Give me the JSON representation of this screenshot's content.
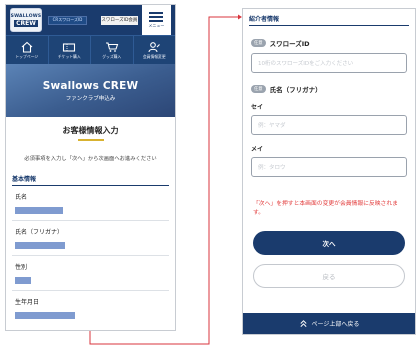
{
  "left": {
    "logo": {
      "line1": "SWALLOWS",
      "line2": "CREW"
    },
    "crew_id_badge": "CRスワローズID",
    "header_button": "スワローズID会員",
    "menu_label": "メニュー",
    "nav": [
      {
        "icon": "home-icon",
        "label": "トップページ"
      },
      {
        "icon": "ticket-icon",
        "label": "チケット購入"
      },
      {
        "icon": "cart-icon",
        "label": "グッズ購入"
      },
      {
        "icon": "user-edit-icon",
        "label": "会員情報変更"
      }
    ],
    "hero": {
      "title": "Swallows CREW",
      "subtitle": "ファンクラブ申込み"
    },
    "form_title": "お客様情報入力",
    "notice": "必須事項を入力し「次へ」から次画面へお進みください",
    "section": "基本情報",
    "fields": [
      {
        "label": "氏名"
      },
      {
        "label": "氏名（フリガナ）"
      },
      {
        "label": "性別"
      },
      {
        "label": "生年月日"
      }
    ]
  },
  "right": {
    "section": "紹介者情報",
    "badge": "任意",
    "id_label": "スワローズID",
    "id_placeholder": "10桁のスワローズIDをご入力ください",
    "name_label": "氏名（フリガナ）",
    "sei_label": "セイ",
    "sei_placeholder": "例：ヤマダ",
    "mei_label": "メイ",
    "mei_placeholder": "例：タロウ",
    "warning": "「次へ」を押すと本画面の変更が会員情報に反映されます。",
    "next_button": "次へ",
    "back_button": "戻る",
    "to_top": "ページ上部へ戻る"
  },
  "colors": {
    "navy": "#1a3b6d",
    "field_bar": "#7f9bd0",
    "warning": "#e23a3a",
    "connector": "#d9363e",
    "accent": "#d8b230"
  }
}
